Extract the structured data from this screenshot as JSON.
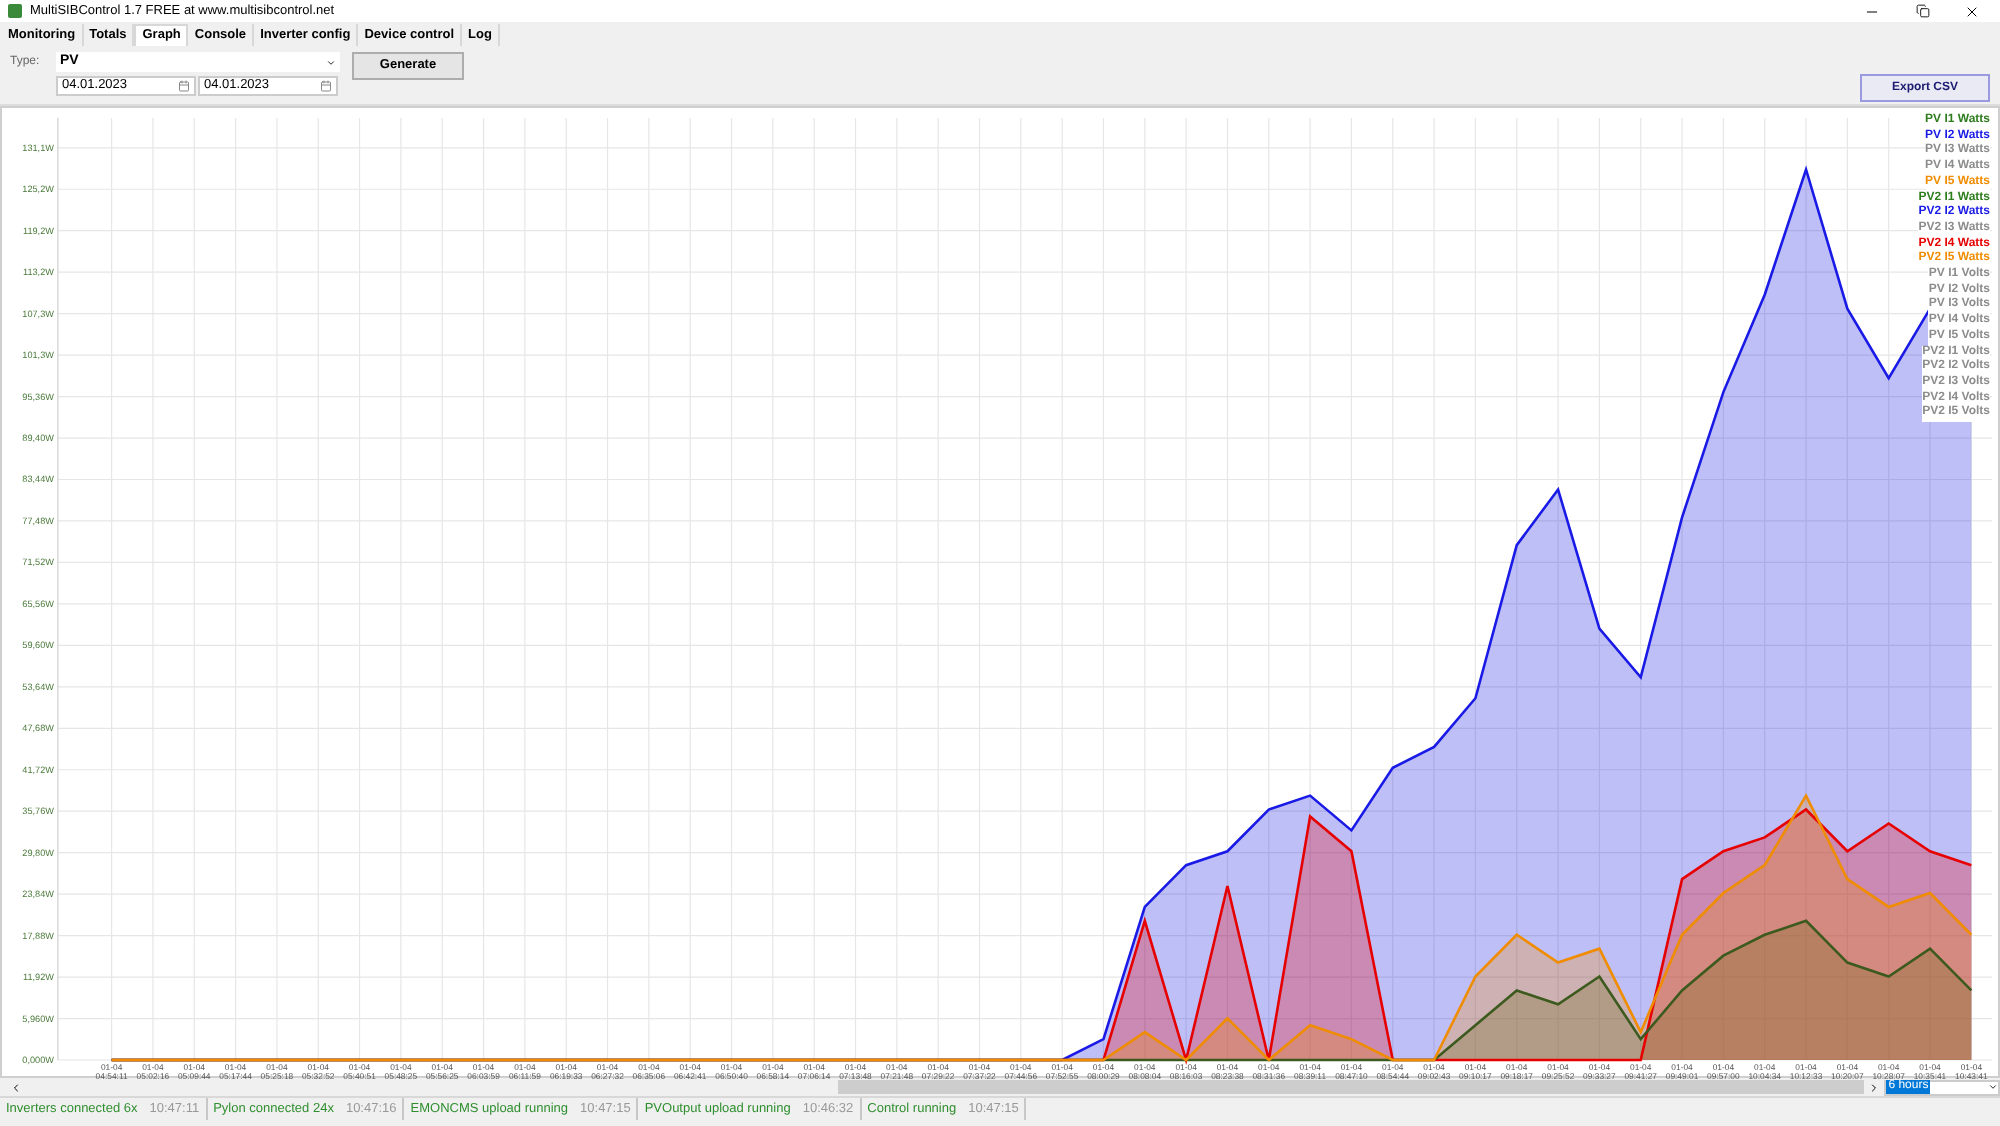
{
  "window": {
    "title": "MultiSIBControl 1.7 FREE at www.multisibcontrol.net"
  },
  "tabs": [
    {
      "label": "Monitoring",
      "selected": false
    },
    {
      "label": "Totals",
      "selected": false
    },
    {
      "label": "Graph",
      "selected": true
    },
    {
      "label": "Console",
      "selected": false
    },
    {
      "label": "Inverter config",
      "selected": false
    },
    {
      "label": "Device control",
      "selected": false
    },
    {
      "label": "Log",
      "selected": false
    }
  ],
  "form": {
    "type_label": "Type:",
    "type_value": "PV",
    "date_from": "04.01.2023",
    "date_to": "04.01.2023",
    "generate": "Generate",
    "export": "Export CSV"
  },
  "legend": [
    {
      "label": "PV I1 Watts",
      "enabled": true,
      "color": "#2e7d1e"
    },
    {
      "label": "PV I2 Watts",
      "enabled": true,
      "color": "#1a1ae6"
    },
    {
      "label": "PV I3 Watts",
      "enabled": false
    },
    {
      "label": "PV I4 Watts",
      "enabled": false
    },
    {
      "label": "PV I5 Watts",
      "enabled": true,
      "color": "#f08c00"
    },
    {
      "label": "PV2 I1 Watts",
      "enabled": true,
      "color": "#2e7d1e"
    },
    {
      "label": "PV2 I2 Watts",
      "enabled": true,
      "color": "#1a1ae6"
    },
    {
      "label": "PV2 I3 Watts",
      "enabled": false
    },
    {
      "label": "PV2 I4 Watts",
      "enabled": true,
      "color": "#e60000"
    },
    {
      "label": "PV2 I5 Watts",
      "enabled": true,
      "color": "#f08c00"
    },
    {
      "label": "PV I1 Volts",
      "enabled": false
    },
    {
      "label": "PV I2 Volts",
      "enabled": false
    },
    {
      "label": "PV I3 Volts",
      "enabled": false
    },
    {
      "label": "PV I4 Volts",
      "enabled": false
    },
    {
      "label": "PV I5 Volts",
      "enabled": false
    },
    {
      "label": "PV2 I1 Volts",
      "enabled": false
    },
    {
      "label": "PV2 I2 Volts",
      "enabled": false
    },
    {
      "label": "PV2 I3 Volts",
      "enabled": false
    },
    {
      "label": "PV2 I4 Volts",
      "enabled": false
    },
    {
      "label": "PV2 I5 Volts",
      "enabled": false
    }
  ],
  "chart_data": {
    "type": "area",
    "categories": [
      "01-04\n04:54:11",
      "01-04\n05:02:16",
      "01-04\n05:09:44",
      "01-04\n05:17:44",
      "01-04\n05:25:18",
      "01-04\n05:32:52",
      "01-04\n05:40:51",
      "01-04\n05:48:25",
      "01-04\n05:56:25",
      "01-04\n06:03:59",
      "01-04\n06:11:59",
      "01-04\n06:19:33",
      "01-04\n06:27:32",
      "01-04\n06:35:06",
      "01-04\n06:42:41",
      "01-04\n06:50:40",
      "01-04\n06:58:14",
      "01-04\n07:06:14",
      "01-04\n07:13:48",
      "01-04\n07:21:48",
      "01-04\n07:29:22",
      "01-04\n07:37:22",
      "01-04\n07:44:56",
      "01-04\n07:52:55",
      "01-04\n08:00:29",
      "01-04\n08:08:04",
      "01-04\n08:16:03",
      "01-04\n08:23:38",
      "01-04\n08:31:36",
      "01-04\n08:39:11",
      "01-04\n08:47:10",
      "01-04\n08:54:44",
      "01-04\n09:02:43",
      "01-04\n09:10:17",
      "01-04\n09:18:17",
      "01-04\n09:25:52",
      "01-04\n09:33:27",
      "01-04\n09:41:27",
      "01-04\n09:49:01",
      "01-04\n09:57:00",
      "01-04\n10:04:34",
      "01-04\n10:12:33",
      "01-04\n10:20:07",
      "01-04\n10:28:07",
      "01-04\n10:35:41",
      "01-04\n10:43:41"
    ],
    "ylim": [
      0,
      135.4
    ],
    "grid": true,
    "yticks": [
      {
        "value": 0,
        "label": "0,000W"
      },
      {
        "value": 5.96,
        "label": "5,960W"
      },
      {
        "value": 11.92,
        "label": "11,92W"
      },
      {
        "value": 17.88,
        "label": "17,88W"
      },
      {
        "value": 23.84,
        "label": "23,84W"
      },
      {
        "value": 29.8,
        "label": "29,80W"
      },
      {
        "value": 35.76,
        "label": "35,76W"
      },
      {
        "value": 41.72,
        "label": "41,72W"
      },
      {
        "value": 47.68,
        "label": "47,68W"
      },
      {
        "value": 53.64,
        "label": "53,64W"
      },
      {
        "value": 59.6,
        "label": "59,60W"
      },
      {
        "value": 65.56,
        "label": "65,56W"
      },
      {
        "value": 71.52,
        "label": "71,52W"
      },
      {
        "value": 77.48,
        "label": "77,48W"
      },
      {
        "value": 83.44,
        "label": "83,44W"
      },
      {
        "value": 89.4,
        "label": "89,40W"
      },
      {
        "value": 95.36,
        "label": "95,36W"
      },
      {
        "value": 101.32,
        "label": "101,3W"
      },
      {
        "value": 107.28,
        "label": "107,3W"
      },
      {
        "value": 113.24,
        "label": "113,2W"
      },
      {
        "value": 119.2,
        "label": "119,2W"
      },
      {
        "value": 125.16,
        "label": "125,2W"
      },
      {
        "value": 131.12,
        "label": "131,1W"
      }
    ],
    "series": [
      {
        "color": "#1a1ae6",
        "values": [
          0,
          0,
          0,
          0,
          0,
          0,
          0,
          0,
          0,
          0,
          0,
          0,
          0,
          0,
          0,
          0,
          0,
          0,
          0,
          0,
          0,
          0,
          0,
          0,
          3,
          22,
          28,
          30,
          36,
          38,
          33,
          42,
          45,
          52,
          74,
          82,
          62,
          55,
          78,
          96,
          110,
          128,
          108,
          98,
          108,
          92
        ]
      },
      {
        "color": "#e60000",
        "values": [
          0,
          0,
          0,
          0,
          0,
          0,
          0,
          0,
          0,
          0,
          0,
          0,
          0,
          0,
          0,
          0,
          0,
          0,
          0,
          0,
          0,
          0,
          0,
          0,
          0,
          20,
          0,
          25,
          0,
          35,
          30,
          0,
          0,
          0,
          0,
          0,
          0,
          0,
          26,
          30,
          32,
          36,
          30,
          34,
          30,
          28
        ]
      },
      {
        "color": "#3d5a1e",
        "values": [
          0,
          0,
          0,
          0,
          0,
          0,
          0,
          0,
          0,
          0,
          0,
          0,
          0,
          0,
          0,
          0,
          0,
          0,
          0,
          0,
          0,
          0,
          0,
          0,
          0,
          0,
          0,
          0,
          0,
          0,
          0,
          0,
          0,
          5,
          10,
          8,
          12,
          3,
          10,
          15,
          18,
          20,
          14,
          12,
          16,
          10
        ]
      },
      {
        "color": "#f08c00",
        "values": [
          0,
          0,
          0,
          0,
          0,
          0,
          0,
          0,
          0,
          0,
          0,
          0,
          0,
          0,
          0,
          0,
          0,
          0,
          0,
          0,
          0,
          0,
          0,
          0,
          0,
          4,
          0,
          6,
          0,
          5,
          3,
          0,
          0,
          12,
          18,
          14,
          16,
          4,
          18,
          24,
          28,
          38,
          26,
          22,
          24,
          18
        ]
      }
    ]
  },
  "range": {
    "value": "6 hours"
  },
  "status_bar": [
    {
      "text": "Inverters connected 6x",
      "time": "10:47:11"
    },
    {
      "text": "Pylon connected 24x",
      "time": "10:47:16"
    },
    {
      "text": "EMONCMS upload running",
      "time": "10:47:15"
    },
    {
      "text": "PVOutput upload running",
      "time": "10:46:32"
    },
    {
      "text": "Control running",
      "time": "10:47:15"
    }
  ]
}
